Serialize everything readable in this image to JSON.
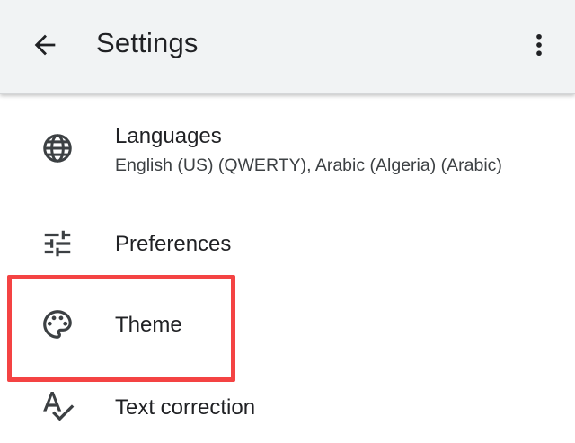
{
  "appbar": {
    "title": "Settings",
    "back_icon": "arrow-back-icon",
    "overflow_icon": "more-vert-icon"
  },
  "settings": {
    "languages": {
      "label": "Languages",
      "summary": "English (US) (QWERTY), Arabic (Algeria) (Arabic)",
      "icon": "globe-icon"
    },
    "preferences": {
      "label": "Preferences",
      "icon": "tune-icon"
    },
    "theme": {
      "label": "Theme",
      "icon": "palette-icon"
    },
    "text_correction": {
      "label": "Text correction",
      "icon": "spellcheck-icon"
    }
  },
  "colors": {
    "appbar_background": "#f1f3f4",
    "text_primary": "#202124",
    "text_secondary": "#3c4043",
    "icon": "#3c4043",
    "highlight_border": "#f44343"
  }
}
